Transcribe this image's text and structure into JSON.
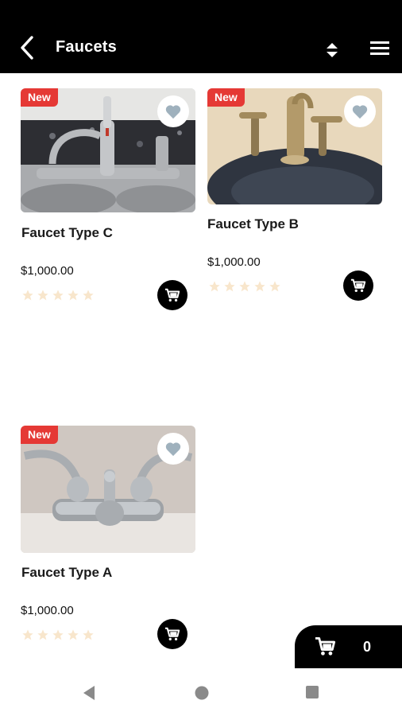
{
  "header": {
    "title": "Faucets",
    "icons": {
      "back": "back-arrow-icon",
      "sort": "sort-icon",
      "menu": "hamburger-menu-icon"
    }
  },
  "products": [
    {
      "name": "Faucet Type C",
      "price": "$1,000.00",
      "badge": "New",
      "rating": 0,
      "max_rating": 5
    },
    {
      "name": "Faucet Type B",
      "price": "$1,000.00",
      "badge": "New",
      "rating": 0,
      "max_rating": 5
    },
    {
      "name": "Faucet Type A",
      "price": "$1,000.00",
      "badge": "New",
      "rating": 0,
      "max_rating": 5
    }
  ],
  "cart": {
    "count": "0",
    "icon": "shopping-cart-icon"
  },
  "navbar": {
    "icons": [
      "nav-back-icon",
      "nav-home-icon",
      "nav-recents-icon"
    ]
  },
  "colors": {
    "bar": "#000000",
    "badge": "#e53935",
    "heart": "#9fb1bd",
    "star": "#f8e6cc"
  }
}
